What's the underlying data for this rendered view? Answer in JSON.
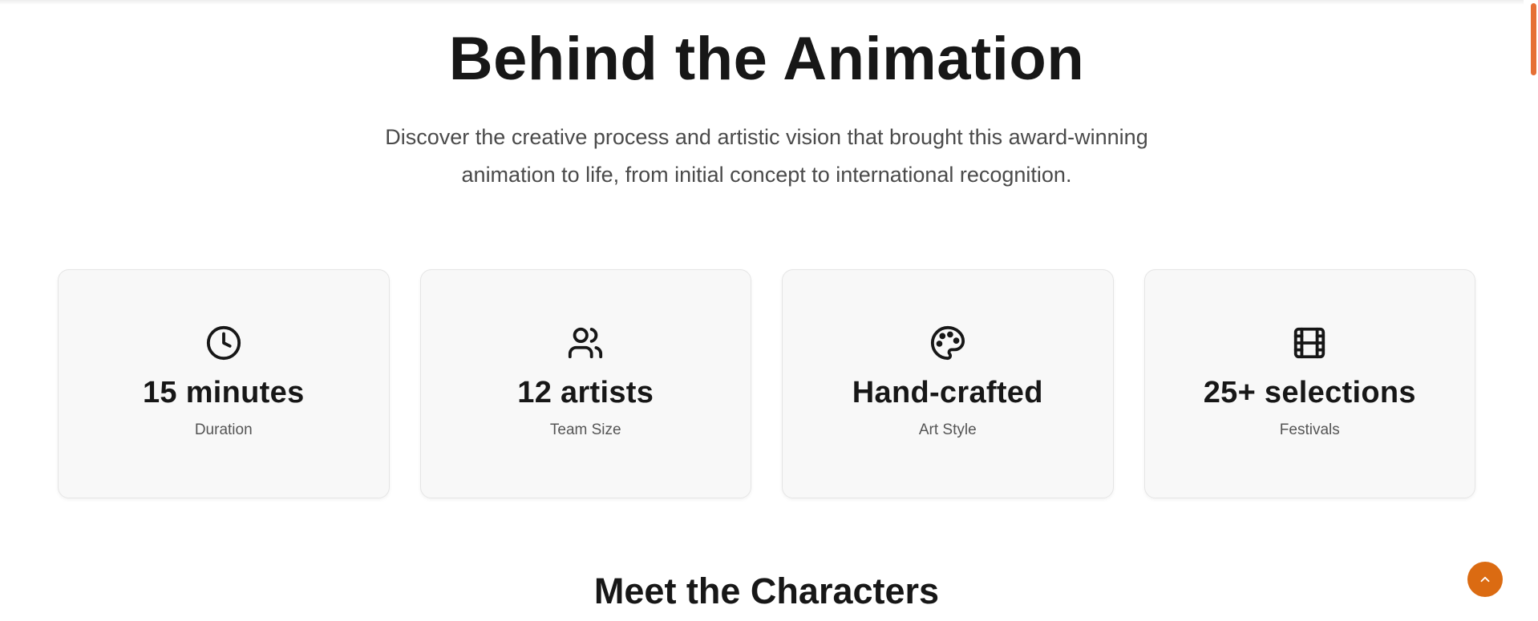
{
  "hero": {
    "title": "Behind the Animation",
    "description": "Discover the creative process and artistic vision that brought this award-winning animation to life, from initial concept to international recognition."
  },
  "stats": [
    {
      "icon": "clock-icon",
      "value": "15 minutes",
      "label": "Duration"
    },
    {
      "icon": "users-icon",
      "value": "12 artists",
      "label": "Team Size"
    },
    {
      "icon": "palette-icon",
      "value": "Hand-crafted",
      "label": "Art Style"
    },
    {
      "icon": "film-icon",
      "value": "25+ selections",
      "label": "Festivals"
    }
  ],
  "characters_section": {
    "title": "Meet the Characters"
  },
  "colors": {
    "accent": "#db6b12",
    "scrollbar_thumb": "#e66f35",
    "text_primary": "#171717",
    "text_secondary": "#4a4a4a",
    "card_background": "#f8f8f8"
  },
  "back_to_top": {
    "icon": "chevron-up-icon"
  }
}
